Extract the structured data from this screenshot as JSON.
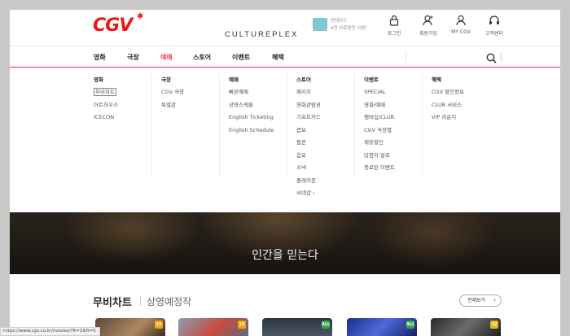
{
  "header": {
    "logo_text": "CGV",
    "logo_sub": "CULTUREPLEX",
    "promo": {
      "line1": "현대카드",
      "line2": "4천 바로원천 사원!"
    },
    "utility": [
      {
        "label": "로그인",
        "icon": "lock-icon"
      },
      {
        "label": "회원가입",
        "icon": "add-user-icon"
      },
      {
        "label": "MY CGV",
        "icon": "user-icon"
      },
      {
        "label": "고객센터",
        "icon": "headset-icon"
      }
    ]
  },
  "nav": {
    "items": [
      "영화",
      "극장",
      "예매",
      "스토어",
      "이벤트",
      "혜택"
    ],
    "active": "예매"
  },
  "mega_menu": {
    "columns": [
      {
        "title": "영화",
        "items": [
          "무비차트",
          "아트하우스",
          "ICECON"
        ]
      },
      {
        "title": "극장",
        "items": [
          "CGV 극장",
          "특별관"
        ]
      },
      {
        "title": "예매",
        "items": [
          "빠른예매",
          "상영스케줄",
          "English Ticketing",
          "English Schedule"
        ]
      },
      {
        "title": "스토어",
        "items": [
          "패키지",
          "영화관람권",
          "기프트카드",
          "콤보",
          "팝콘",
          "음료",
          "스낵",
          "플레이존",
          "씨네샵 ›"
        ]
      },
      {
        "title": "이벤트",
        "items": [
          "SPECIAL",
          "영화/예매",
          "멤버십/CLUB",
          "CGV 극장별",
          "제휴할인",
          "당첨자 발표",
          "종료된 이벤트"
        ]
      },
      {
        "title": "혜택",
        "items": [
          "CGV 할인정보",
          "CLUB 서비스",
          "VIP 라운지"
        ]
      }
    ]
  },
  "hero": {
    "caption": "인간을 믿는다"
  },
  "chart_section": {
    "tab_main": "무비차트",
    "tab_sub": "상영예정작",
    "see_all": "전체보기",
    "posters": [
      {
        "age": "15",
        "age_color": "#f4a30a"
      },
      {
        "age": "15",
        "age_color": "#f4a30a"
      },
      {
        "age": "ALL",
        "age_color": "#3aa04a"
      },
      {
        "age": "ALL",
        "age_color": "#3aa04a"
      },
      {
        "age": "12",
        "age_color": "#e5b814"
      }
    ]
  },
  "statusbar": {
    "url": "https://www.cgv.co.kr/movies/?lt=1&ft=0"
  },
  "colors": {
    "brand_red": "#e71a0f",
    "active_pink": "#fb4357",
    "nav_line": "#e2363f"
  }
}
